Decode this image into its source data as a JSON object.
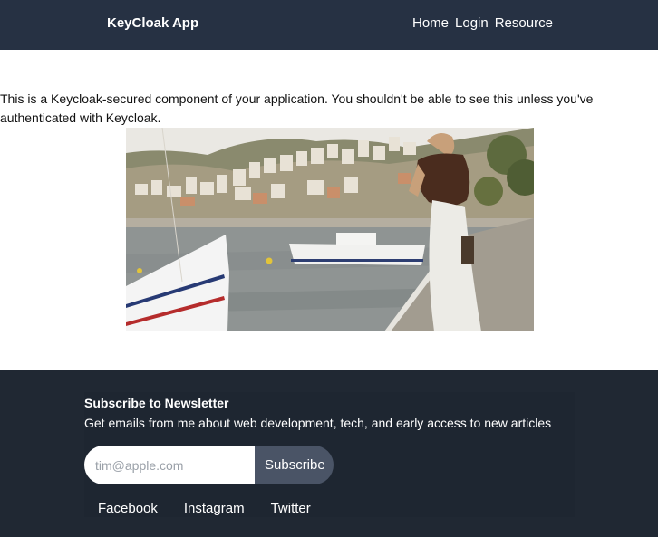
{
  "header": {
    "brand": "KeyCloak App",
    "nav": [
      "Home",
      "Login",
      "Resource"
    ]
  },
  "main": {
    "intro_text": "This is a Keycloak-secured component of your application. You shouldn't be able to see this unless you've authenticated with Keycloak."
  },
  "footer": {
    "newsletter_title": "Subscribe to Newsletter",
    "newsletter_desc": "Get emails from me about web development, tech, and early access to new articles",
    "email_placeholder": "tim@apple.com",
    "email_value": "",
    "subscribe_label": "Subscribe",
    "social": [
      "Facebook",
      "Instagram",
      "Twitter"
    ]
  },
  "colors": {
    "header_bg": "#263143",
    "footer_bg": "#202833",
    "button_bg": "#4a5466"
  }
}
